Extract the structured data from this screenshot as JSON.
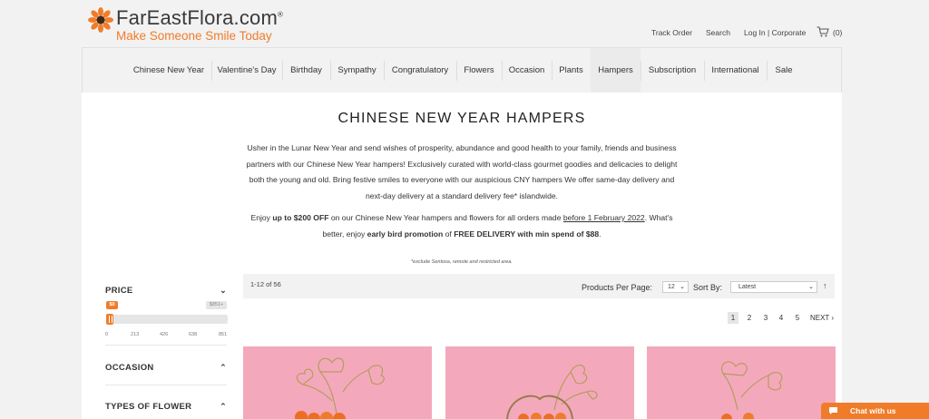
{
  "header": {
    "brand_name": "FarEastFlora.com",
    "brand_mark": "®",
    "tagline": "Make Someone Smile Today",
    "utility_links": [
      "Track Order",
      "Search",
      "Log In | Corporate"
    ],
    "cart_count": "(0)"
  },
  "nav": {
    "items": [
      "Chinese New Year",
      "Valentine's Day",
      "Birthday",
      "Sympathy",
      "Congratulatory",
      "Flowers",
      "Occasion",
      "Plants",
      "Hampers",
      "Subscription",
      "International",
      "Sale"
    ]
  },
  "page": {
    "title": "CHINESE NEW YEAR HAMPERS",
    "intro": "Usher in the Lunar New Year and send wishes of prosperity, abundance and good health to your family, friends and business partners with our Chinese New Year hampers! Exclusively curated with world-class gourmet goodies and delicacies to delight both the young and old. Bring festive smiles to everyone with our auspicious CNY hampers We offer same-day delivery and next-day delivery at a standard delivery fee* islandwide.",
    "promo_1": "Enjoy ",
    "promo_2": "up to $200 OFF",
    "promo_3": " on our Chinese New Year hampers and flowers for all orders made ",
    "promo_4": "before 1 February 2022",
    "promo_5": ". What's better, enjoy ",
    "promo_6": "early bird promotion",
    "promo_7": " of ",
    "promo_8": "FREE DELIVERY with min spend of $88",
    "promo_9": ".",
    "footnote": "*exclude Sentosa, remote and restricted area."
  },
  "filters": {
    "price_heading": "PRICE",
    "price_min_label": "$0",
    "price_max_label": "$851+",
    "price_ticks": [
      "0",
      "213",
      "426",
      "638",
      "851"
    ],
    "price_selected_fraction": 0.0,
    "occasion_heading": "OCCASION",
    "flower_heading": "TYPES OF FLOWER"
  },
  "listing": {
    "count": "1-12 of 56",
    "per_page_label": "Products Per Page:",
    "per_page_value": "12",
    "sort_label": "Sort By:",
    "sort_value": "Latest",
    "pages": [
      "1",
      "2",
      "3",
      "4",
      "5"
    ],
    "next_label": "NEXT ›"
  },
  "chat": {
    "label": "Chat with us"
  },
  "colors": {
    "brand_orange": "#f07c2a",
    "product_bg": "#f3a9bb"
  }
}
